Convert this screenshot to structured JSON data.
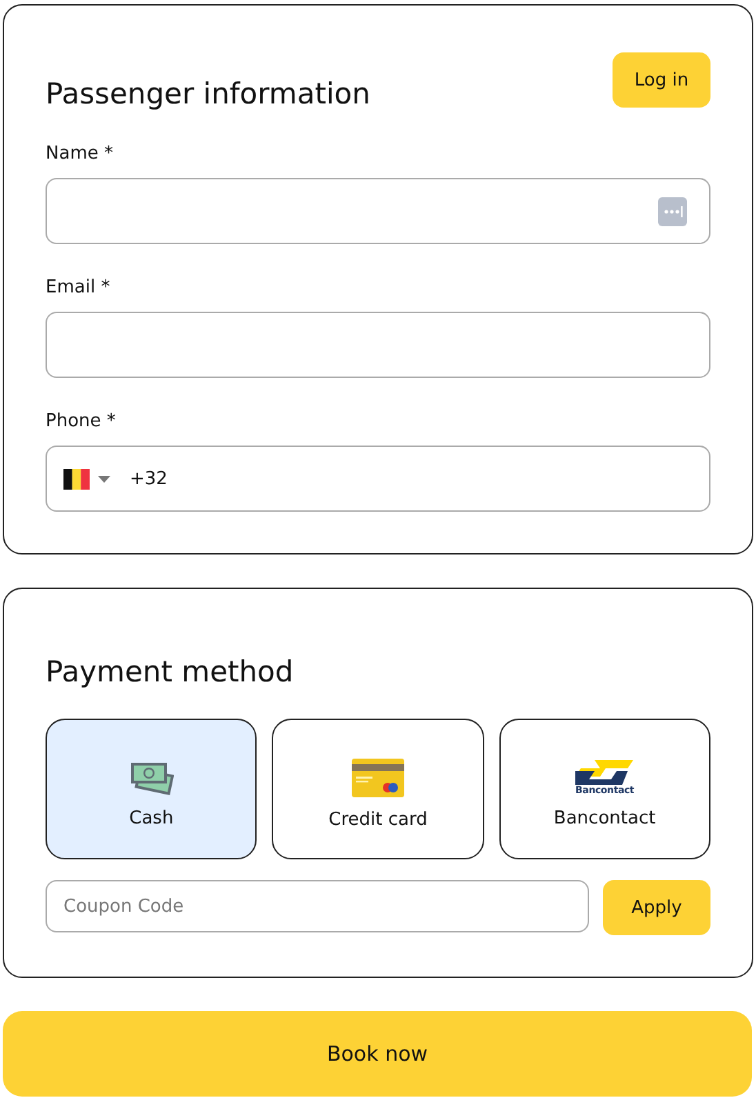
{
  "passenger": {
    "title": "Passenger information",
    "login_button": "Log in",
    "fields": [
      {
        "kind": "name",
        "label": "Name *"
      },
      {
        "kind": "email",
        "label": "Email *"
      },
      {
        "kind": "phone",
        "label": "Phone *",
        "value": "+32"
      }
    ]
  },
  "payment": {
    "title": "Payment method",
    "methods": [
      {
        "kind": "cash",
        "label": "Cash",
        "selected": true
      },
      {
        "kind": "card",
        "label": "Credit card",
        "selected": false
      },
      {
        "kind": "bancontact",
        "label": "Bancontact",
        "logo_text": "Bancontact",
        "selected": false
      }
    ],
    "coupon": {
      "placeholder": "Coupon Code"
    },
    "apply_button": "Apply"
  },
  "book_button": "Book now"
}
